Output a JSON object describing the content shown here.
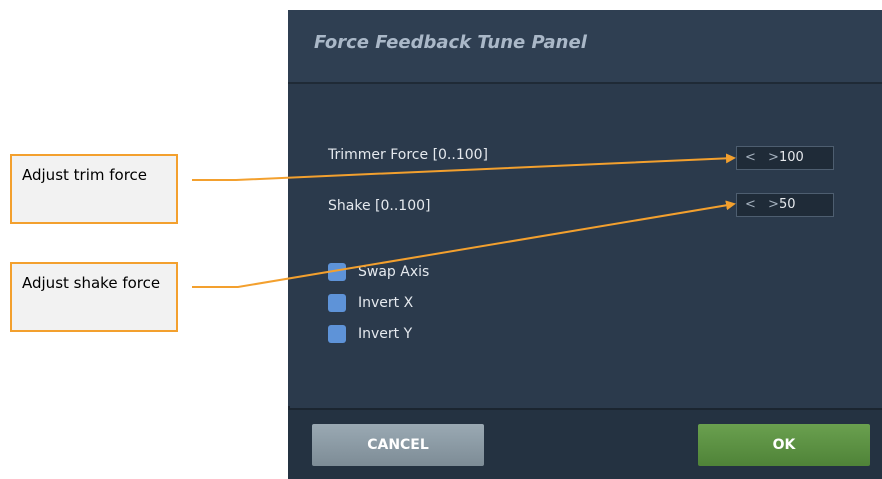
{
  "panel": {
    "title": "Force Feedback Tune Panel",
    "fields": [
      {
        "label": "Trimmer Force [0..100]",
        "arrows": "< >",
        "value": "100"
      },
      {
        "label": "Shake [0..100]",
        "arrows": "< >",
        "value": "50"
      }
    ],
    "checkboxes": [
      {
        "label": "Swap Axis"
      },
      {
        "label": "Invert X"
      },
      {
        "label": "Invert Y"
      }
    ],
    "buttons": {
      "cancel": "CANCEL",
      "ok": "OK"
    }
  },
  "callouts": [
    {
      "text": "Adjust trim force"
    },
    {
      "text": "Adjust shake force"
    }
  ],
  "colors": {
    "panel_bg": "#2b3a4c",
    "accent_orange": "#f3a02e",
    "checkbox_blue": "#5e93d8",
    "ok_green": "#5a8f40",
    "cancel_gray": "#8a98a2"
  }
}
